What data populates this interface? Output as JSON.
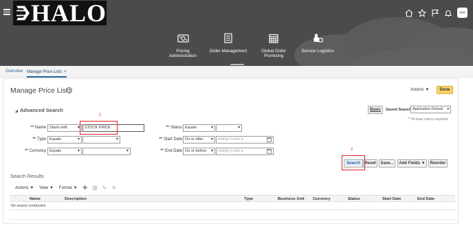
{
  "header": {
    "logo_text": "HALO",
    "avatar_initials": "HH",
    "icons": [
      "home-icon",
      "star-icon",
      "flag-icon",
      "bell-icon"
    ]
  },
  "springboard": [
    {
      "icon": "pricing-icon",
      "line1": "Pricing",
      "line2": "Administration"
    },
    {
      "icon": "order-icon",
      "line1": "Order Management",
      "line2": ""
    },
    {
      "icon": "calendar-icon",
      "line1": "Global Order",
      "line2": "Promising"
    },
    {
      "icon": "logistics-icon",
      "line1": "Service Logistics",
      "line2": ""
    }
  ],
  "tabs": [
    {
      "label": "Overview",
      "active": false
    },
    {
      "label": "Manage Price Lists",
      "active": true,
      "close": "×"
    }
  ],
  "page": {
    "title": "Manage Price Lists",
    "help": "?",
    "actions_label": "Actions ▼",
    "done_label": "Done"
  },
  "search": {
    "title": "Advanced Search",
    "basic_label": "Basic",
    "saved_search_label": "Saved Search",
    "saved_search_value": "Application Default",
    "atleast_note": "** At least one is required",
    "fields": {
      "name": {
        "label": "Name",
        "operator": "Starts with",
        "value": "STOCK PRICE"
      },
      "type": {
        "label": "Type",
        "operator": "Equals",
        "value": ""
      },
      "currency": {
        "label": "Currency",
        "operator": "Equals",
        "value": ""
      },
      "status": {
        "label": "Status",
        "operator": "Equals",
        "value": ""
      },
      "start_date": {
        "label": "Start Date",
        "operator": "On or after",
        "placeholder": "m/d/yy h:mm a"
      },
      "end_date": {
        "label": "End Date",
        "operator": "On or before",
        "placeholder": "m/d/yy h:mm a"
      }
    },
    "required_marker": "**",
    "buttons": {
      "search": "Search",
      "reset": "Reset",
      "save": "Save...",
      "add_fields": "Add Fields ▼",
      "reorder": "Reorder"
    },
    "annotations": [
      "1",
      "2"
    ]
  },
  "results": {
    "title": "Search Results",
    "toolbar": {
      "actions": "Actions ▼",
      "view": "View ▼",
      "format": "Format ▼"
    },
    "columns": [
      "Name",
      "Description",
      "Type",
      "Business Unit",
      "Currency",
      "Status",
      "Start Date",
      "End Date"
    ],
    "empty_message": "No search conducted"
  },
  "colors": {
    "header_bg": "#4b4b4d",
    "accent": "#1c5d9b",
    "done_button": "#f9d26a",
    "annotation_red": "#e02020"
  }
}
